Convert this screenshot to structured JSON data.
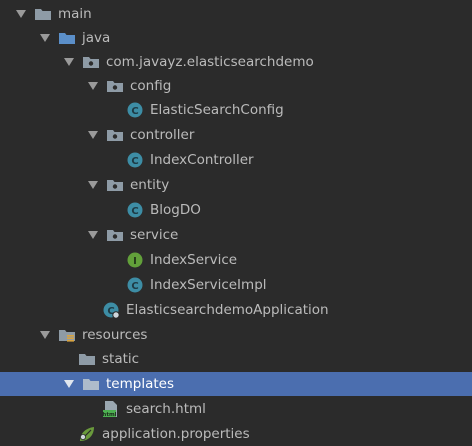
{
  "tree": {
    "main": "main",
    "java": "java",
    "package_root": "com.javayz.elasticsearchdemo",
    "config": "config",
    "config_class": "ElasticSearchConfig",
    "controller": "controller",
    "controller_class": "IndexController",
    "entity": "entity",
    "entity_class": "BlogDO",
    "service": "service",
    "service_interface": "IndexService",
    "service_impl": "IndexServiceImpl",
    "app_class": "ElasticsearchdemoApplication",
    "resources": "resources",
    "static": "static",
    "templates": "templates",
    "template_file": "search.html",
    "properties_file": "application.properties"
  },
  "colors": {
    "background": "#2b2b2b",
    "selection": "#4b6eaf",
    "text": "#bbbbbb",
    "folder": "#8e9ba6",
    "source_folder": "#5b8fc9",
    "class_icon": "#3d8da5",
    "interface_icon": "#62a03a",
    "spring_icon": "#6a9a3c"
  },
  "icons": {
    "folder": "folder-icon",
    "source_folder": "source-folder-icon",
    "package": "package-icon",
    "class": "class-icon",
    "interface": "interface-icon",
    "spring_boot_class": "spring-boot-class-icon",
    "resources_folder": "resources-folder-icon",
    "html_file": "html-file-icon",
    "properties_file": "spring-properties-icon"
  }
}
